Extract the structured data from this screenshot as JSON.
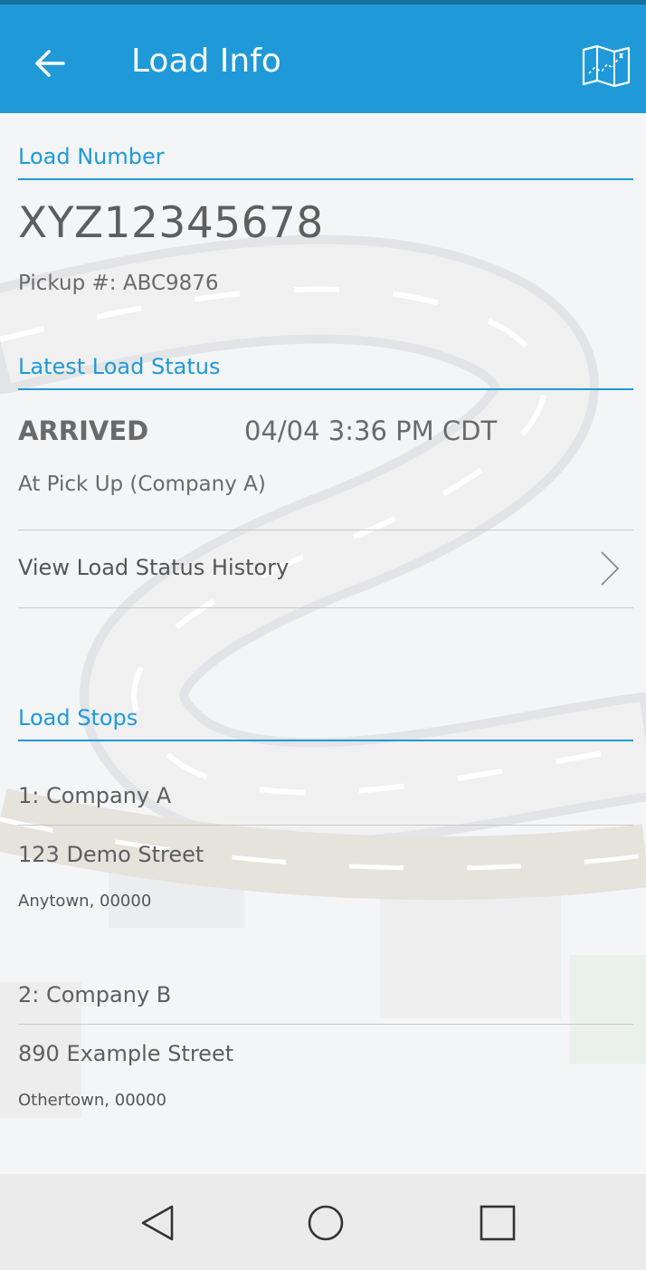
{
  "app_bar": {
    "title": "Load Info",
    "back_icon": "arrow-left-icon",
    "map_icon": "folded-map-icon",
    "color": "#1f99d8"
  },
  "load_number": {
    "section_label": "Load Number",
    "value": "XYZ12345678",
    "pickup": "Pickup #: ABC9876"
  },
  "latest_status": {
    "section_label": "Latest Load Status",
    "status": "ARRIVED",
    "timestamp": "04/04 3:36 PM CDT",
    "location": "At Pick Up (Company A)",
    "history_link": "View Load Status History"
  },
  "stops": {
    "section_label": "Load Stops",
    "items": [
      {
        "name": "1: Company A",
        "street": "123 Demo Street",
        "city": "Anytown,  00000"
      },
      {
        "name": "2: Company B",
        "street": "890 Example Street",
        "city": "Othertown,  00000"
      }
    ]
  },
  "nav_bar": {
    "back_icon": "triangle-back-icon",
    "home_icon": "circle-home-icon",
    "recents_icon": "square-recents-icon"
  }
}
